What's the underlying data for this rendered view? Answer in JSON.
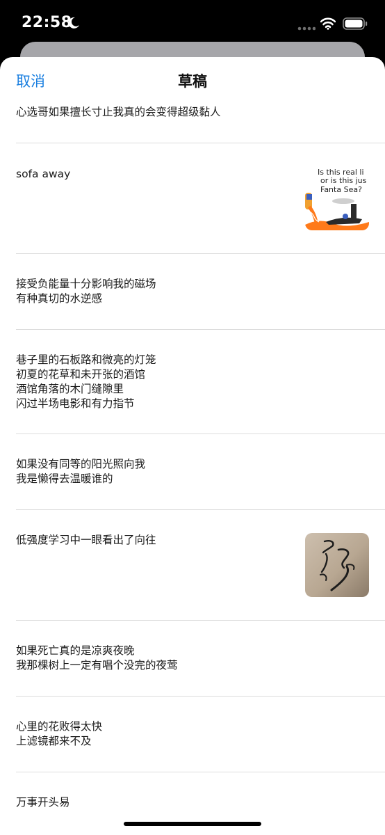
{
  "status_bar": {
    "time": "22:58"
  },
  "nav": {
    "cancel_label": "取消",
    "title": "草稿"
  },
  "drafts": [
    {
      "text": "心选哥如果擅长寸止我真的会变得超级黏人"
    },
    {
      "text": "sofa away",
      "thumbnail": {
        "text_line1": "Is this real li",
        "text_line2": "or is this jus",
        "text_line3": "Fanta Sea?"
      }
    },
    {
      "text": "接受负能量十分影响我的磁场\n有种真切的水逆感"
    },
    {
      "text": "巷子里的石板路和微亮的灯笼\n初夏的花草和未开张的酒馆\n酒馆角落的木门缝隙里\n闪过半场电影和有力指节"
    },
    {
      "text": "如果没有同等的阳光照向我\n我是懒得去温暖谁的"
    },
    {
      "text": "低强度学习中一眼看出了向往"
    },
    {
      "text": "如果死亡真的是凉爽夜晚\n我那棵树上一定有唱个没完的夜莺"
    },
    {
      "text": "心里的花败得太快\n上滤镜都来不及"
    },
    {
      "text": "万事开头易"
    }
  ],
  "colors": {
    "accent": "#1a7fe0",
    "text": "#1a1a1a",
    "separator": "#dcdcdc"
  },
  "icons": [
    "moon-icon",
    "signal-icon",
    "wifi-icon",
    "battery-icon"
  ]
}
